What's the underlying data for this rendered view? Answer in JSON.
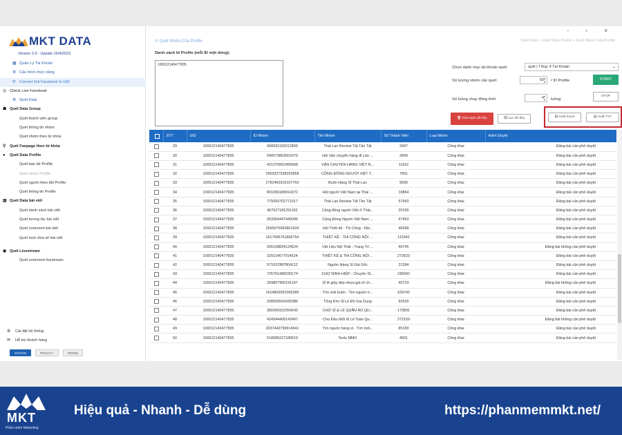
{
  "window": {
    "controls": "- ▫ ×"
  },
  "brand": {
    "name": "MKT DATA",
    "version": "Version 2.0 - Update 16/4/2023"
  },
  "sidebar": {
    "items": [
      {
        "label": "Quản Lý Tài Khoản",
        "type": "sub",
        "icon": "table-icon",
        "style": "blue"
      },
      {
        "label": "Cấu hình chức năng",
        "type": "sub",
        "icon": "gear-icon",
        "style": "blue"
      },
      {
        "label": "Convert link Facebook to UID",
        "type": "sub",
        "icon": "refresh-icon",
        "style": "active"
      },
      {
        "label": "Check Live Facebook",
        "type": "sec-plain",
        "icon": "check-circle-icon",
        "style": ""
      },
      {
        "label": "Quét Data",
        "type": "sub",
        "icon": "gear-icon",
        "style": "blue"
      },
      {
        "label": "Quét Data Group",
        "type": "sec",
        "icon": "group-icon",
        "style": ""
      },
      {
        "label": "Quét thành viên group",
        "type": "item",
        "icon": "",
        "style": ""
      },
      {
        "label": "Quét thông tin nhóm",
        "type": "item",
        "icon": "",
        "style": ""
      },
      {
        "label": "Quét nhóm theo từ khóa",
        "type": "item",
        "icon": "",
        "style": ""
      },
      {
        "label": "Quét Fanpage theo từ khóa",
        "type": "sec",
        "icon": "search-icon",
        "style": ""
      },
      {
        "label": "Quét Data Profile",
        "type": "sec",
        "icon": "user-icon",
        "style": ""
      },
      {
        "label": "Quét bạn bè Profile",
        "type": "item",
        "icon": "",
        "style": ""
      },
      {
        "label": "Quét nhóm Profile",
        "type": "item",
        "icon": "",
        "style": "dim"
      },
      {
        "label": "Quét người theo dõi Profile",
        "type": "item",
        "icon": "",
        "style": ""
      },
      {
        "label": "Quét thông tin Profile",
        "type": "item",
        "icon": "",
        "style": ""
      },
      {
        "label": "Quét Data bài viết",
        "type": "sec",
        "icon": "document-icon",
        "style": ""
      },
      {
        "label": "Quét danh sách bài viết",
        "type": "item",
        "icon": "",
        "style": ""
      },
      {
        "label": "Quét tương tác bài viết",
        "type": "item",
        "icon": "",
        "style": ""
      },
      {
        "label": "Quét comment bài viết",
        "type": "item",
        "icon": "",
        "style": ""
      },
      {
        "label": "Quét lượt chia sẻ bài viết",
        "type": "item",
        "icon": "",
        "style": ""
      },
      {
        "label": "",
        "type": "gap",
        "icon": "",
        "style": ""
      },
      {
        "label": "Quét Livestream",
        "type": "sec",
        "icon": "broadcast-icon",
        "style": ""
      },
      {
        "label": "Quét comment livestream",
        "type": "item",
        "icon": "",
        "style": ""
      }
    ],
    "footer": [
      {
        "label": "Cài đặt hệ thống",
        "icon": "gear-icon"
      },
      {
        "label": "Hỗ trợ khách hàng",
        "icon": "chat-icon"
      }
    ],
    "buttons": [
      "STATUS",
      "PRIVACY",
      "TERMS"
    ]
  },
  "main": {
    "breadcrumb": "Quét Nhóm Của Profile",
    "breadcrumb_right": "Quét Data > Quét Data Profile > Quét Nhóm Của Profile",
    "list_label": "Danh sách Id Profile (mỗi ID một dòng):",
    "list_value": "100012140477835",
    "account_label": "Chọn danh mục tài khoản quét:",
    "account_value": "quét | Tổng: 4 Tài Khoản",
    "groups_label": "Số lượng nhóm cần quét:",
    "groups_value": "50",
    "groups_unit": "/ ID Profile",
    "threads_label": "Số luồng chạy đồng thời:",
    "threads_value": "4",
    "threads_unit": "luồng",
    "start": "START",
    "stop": "STOP",
    "clear": "Xóa sạch dữ liệu",
    "filter": "Lọc dữ liệu",
    "export_excel": "Xuất Excel",
    "export_txt": "Xuất TXT"
  },
  "table": {
    "headers": [
      "STT",
      "UID",
      "ID Nhóm",
      "Tên Nhóm",
      "Số Thành Viên",
      "Loại Nhóm",
      "Kiểm Duyệt"
    ],
    "rows": [
      [
        "29",
        "100012140477835",
        "666591165012893",
        "Thái Lan Review Tất Tần Tật",
        "3497",
        "Công khai",
        "Đăng bài cần phê duyệt"
      ],
      [
        "30",
        "100012140477835",
        "540573863601679",
        "Hội Vận chuyển hàng đi Lào ...",
        "2849",
        "Công khai",
        "Đăng bài cần phê duyệt"
      ],
      [
        "31",
        "100012140477835",
        "421370902455668",
        "VẬN CHUYỂN HÀNG VIỆT N...",
        "11162",
        "Công khai",
        "Đăng bài cần phê duyệt"
      ],
      [
        "32",
        "100012140477835",
        "2953327538253858",
        "CỘNG ĐỒNG NGƯỜI VIỆT T...",
        "7891",
        "Công khai",
        "Đăng bài cần phê duyệt"
      ],
      [
        "33",
        "100012140477835",
        "2782462915107760",
        "Buôn Hàng Sỉ Thái Lan",
        "9590",
        "Công khai",
        "Đăng bài cần phê duyệt"
      ],
      [
        "34",
        "100012140477835",
        "801056189914372",
        "Hội người Việt Nam tại Thái ...",
        "19864",
        "Công khai",
        "Đăng bài cần phê duyệt"
      ],
      [
        "35",
        "100012140477835",
        "779393702771917",
        "Thái Lan Review Tất Tần Tật",
        "57943",
        "Công khai",
        "Đăng bài cần phê duyệt"
      ],
      [
        "36",
        "100012140477835",
        "467527181291162",
        "Cộng đồng người Việt ở Thái...",
        "20190",
        "Công khai",
        "Đăng bài cần phê duyệt"
      ],
      [
        "37",
        "100012140477835",
        "263364447440049",
        "Cộng Đồng Người Việt Nam ...",
        "47463",
        "Công khai",
        "Đăng bài cần phê duyệt"
      ],
      [
        "38",
        "100012140477835",
        "2695975963861504",
        "Hội Thiết kế - Thi Công - Nội...",
        "46289",
        "Công khai",
        "Đăng bài cần phê duyệt"
      ],
      [
        "39",
        "100012140477835",
        "1617696761866754",
        "THIẾT KẾ - THI CÔNG NỘI ...",
        "115942",
        "Công khai",
        "Đăng bài cần phê duyệt"
      ],
      [
        "40",
        "100012140477835",
        "265158834124524",
        "Vật Liệu Nội Thất - Trang Trí ...",
        "40745",
        "Công khai",
        "Đăng bài không cần phê duyệt"
      ],
      [
        "41",
        "100012140477835",
        "325114677914524",
        "THIẾT KẾ & THI CÔNG NỘI ...",
        "273523",
        "Công khai",
        "Đăng bài cần phê duyệt"
      ],
      [
        "42",
        "100012140477835",
        "571637887804112",
        "Nguồn Hàng Sỉ Giá Gốc",
        "21394",
        "Công khai",
        "Đăng bài cần phê duyệt"
      ],
      [
        "43",
        "100012140477835",
        "725701498230174",
        "CHỢ NINH HIỆP - Chuyên Sỉ...",
        "236942",
        "Công khai",
        "Đăng bài cần phê duyệt"
      ],
      [
        "44",
        "100012140477835",
        "269807900191147",
        "Sỉ lẻ giày dép nhựa giá rẻ ch...",
        "40723",
        "Công khai",
        "Đăng bài không cần phê duyệt"
      ],
      [
        "45",
        "100012140477835",
        "1914803952065285",
        "Tìm mối buôn - Tìm nguồn h...",
        "109742",
        "Công khai",
        "Đăng bài cần phê duyệt"
      ],
      [
        "46",
        "100012140477835",
        "308505563436386",
        "Tổng Kho Sỉ Lẻ Đồ Gia Dụng",
        "92630",
        "Công khai",
        "Đăng bài cần phê duyệt"
      ],
      [
        "47",
        "100012140477835",
        "380269152394242",
        "CHỢ SỈ & LẺ QUẦN ÁO QU...",
        "173891",
        "Công khai",
        "Đăng bài cần phê duyệt"
      ],
      [
        "48",
        "100012140477835",
        "424344408143497",
        "Chợ Đầu Mối Sỉ Lẻ Toàn Qu...",
        "272159",
        "Công khai",
        "Đăng bài không cần phê duyệt"
      ],
      [
        "49",
        "100012140477835",
        "2637442799914541",
        "Tìm nguồn hàng sỉ - Tìm mối...",
        "85159",
        "Công khai",
        "Đăng bài cần phê duyệt"
      ],
      [
        "50",
        "100012140477835",
        "518085227189619",
        "Tools MMO",
        "4501",
        "Công khai",
        "Đăng bài cần phê duyệt"
      ]
    ]
  },
  "banner": {
    "logo": "MKT",
    "logo_sub": "Phần mềm Marketing",
    "tagline": "Hiệu quả - Nhanh - Dễ dùng",
    "url": "https://phanmemmkt.net/"
  },
  "colors": {
    "brand": "#1e3f8f",
    "header": "#1e6cc4",
    "start": "#2aa777",
    "danger": "#d9433f",
    "banner": "#19438f"
  }
}
